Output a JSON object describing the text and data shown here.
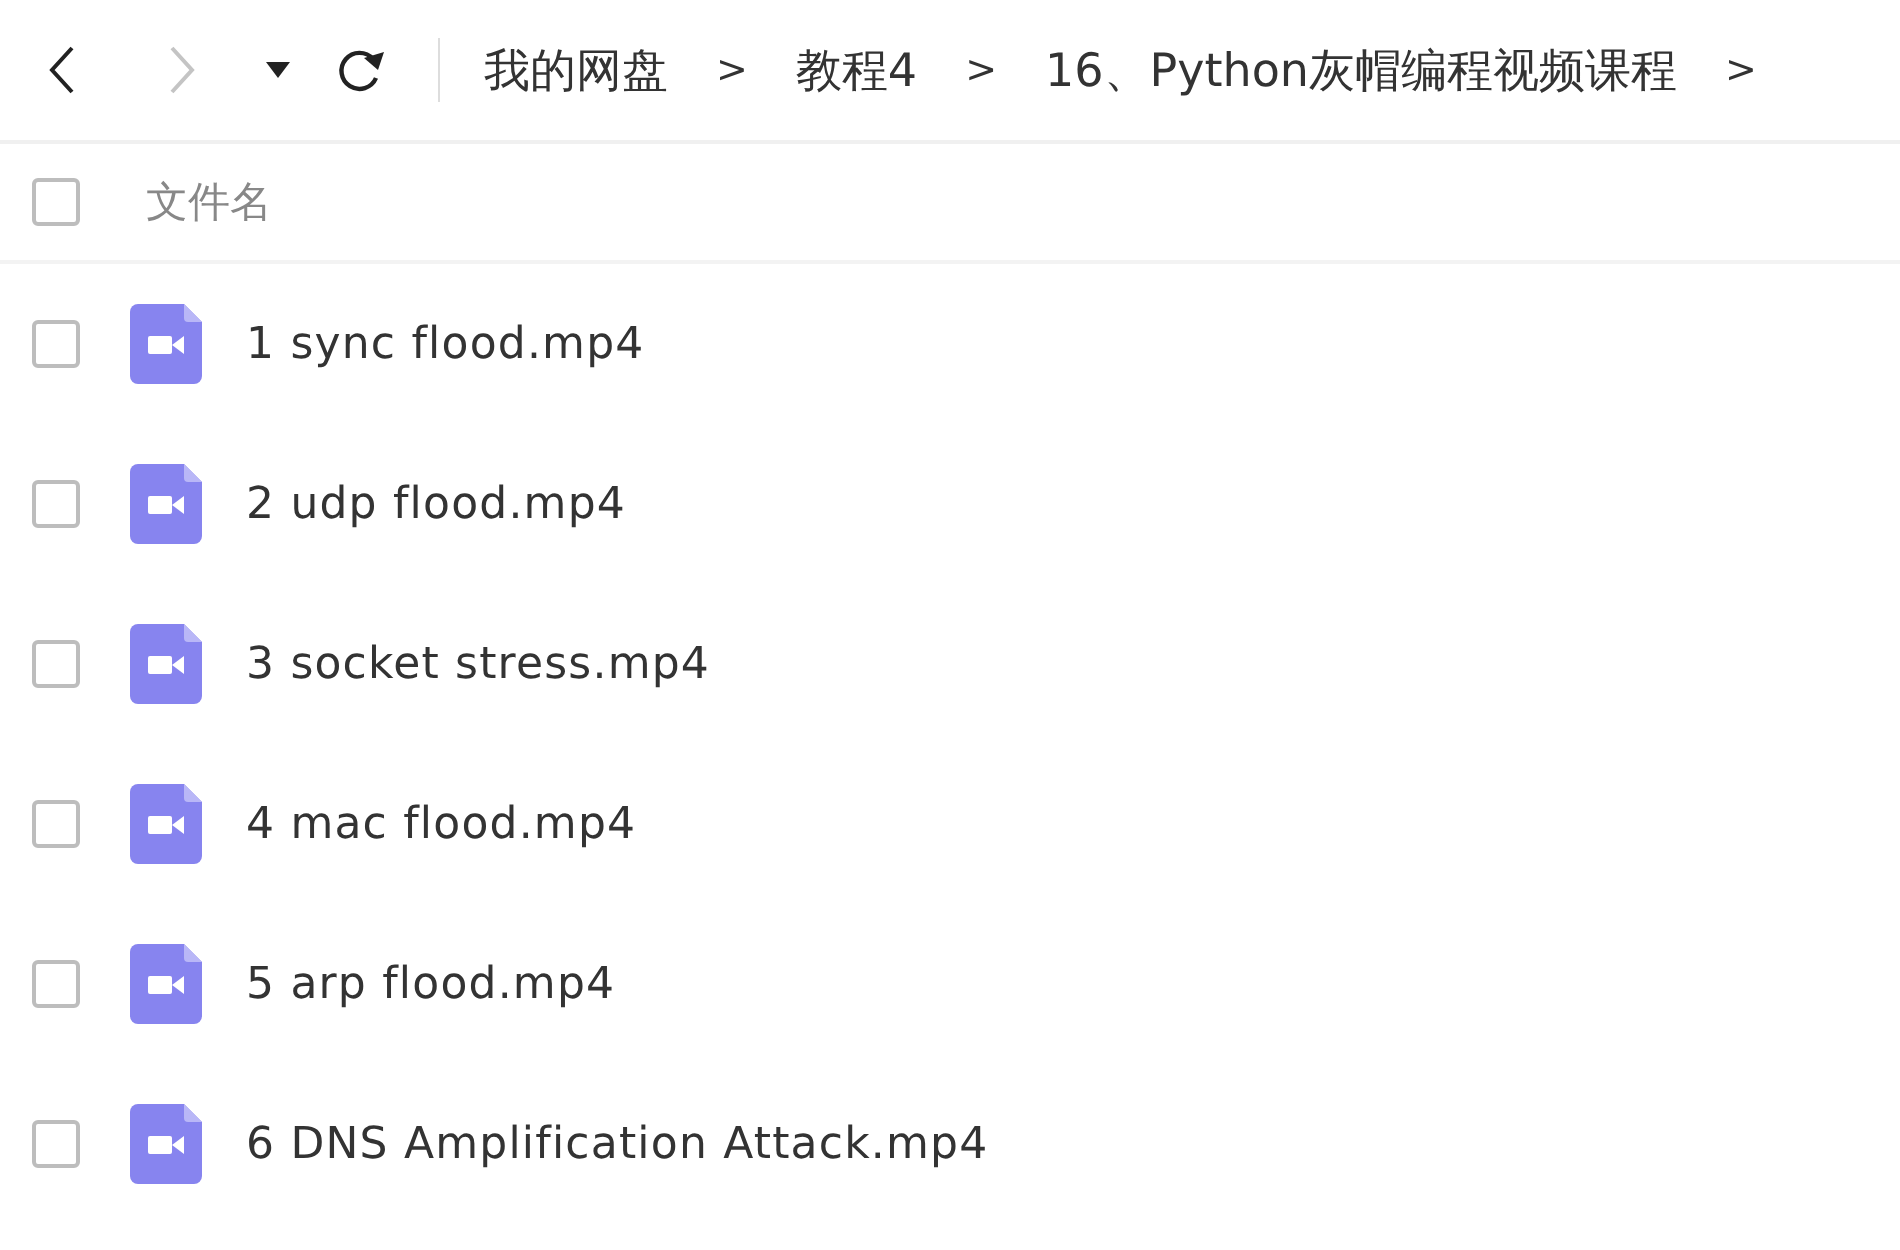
{
  "toolbar": {
    "back": {
      "disabled": false
    },
    "forward": {
      "disabled": true
    }
  },
  "breadcrumbs": [
    {
      "label": "我的网盘",
      "separator": ">"
    },
    {
      "label": "教程4",
      "separator": ">"
    },
    {
      "label": "16、Python灰帽编程视频课程",
      "separator": ">"
    }
  ],
  "header": {
    "checked": false,
    "column": "文件名"
  },
  "files": [
    {
      "name": "1 sync flood.mp4",
      "checked": false
    },
    {
      "name": "2 udp flood.mp4",
      "checked": false
    },
    {
      "name": "3 socket stress.mp4",
      "checked": false
    },
    {
      "name": "4 mac flood.mp4",
      "checked": false
    },
    {
      "name": "5 arp flood.mp4",
      "checked": false
    },
    {
      "name": "6 DNS Amplification Attack.mp4",
      "checked": false
    }
  ]
}
